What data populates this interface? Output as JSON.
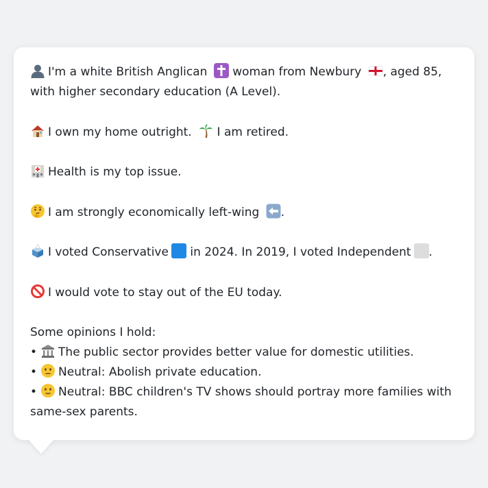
{
  "profile": {
    "line1_a": "I'm a white British Anglican",
    "line1_b": "woman from Newbury",
    "line1_c": ", aged 85, with higher secondary education (A Level).",
    "home": "I own my home outright.",
    "retired": "I am retired.",
    "health": "Health is my top issue.",
    "econ": "I am strongly economically left-wing",
    "econ_end": ".",
    "vote_a": "I voted Conservative",
    "vote_b": "in 2024. In 2019, I voted Independent",
    "vote_end": ".",
    "eu": "I would vote to stay out of the EU today.",
    "opinions_title": "Some opinions I hold:",
    "opinions": [
      {
        "bullet": "•",
        "text": "The public sector provides better value for domestic utilities."
      },
      {
        "bullet": "•",
        "text": "Neutral: Abolish private education."
      },
      {
        "bullet": "•",
        "text": "Neutral: BBC children's TV shows should portray more families with same-sex parents."
      }
    ]
  },
  "icons": {
    "person": "person-icon",
    "cross": "latin-cross-icon",
    "england_flag": "england-flag-icon",
    "house": "house-icon",
    "palm": "palm-tree-icon",
    "hospital": "hospital-icon",
    "thinking": "thinking-face-icon",
    "left_arrow": "left-arrow-icon",
    "ballot": "ballot-box-icon",
    "no_entry": "prohibited-icon",
    "classical_building": "classical-building-icon",
    "neutral_face": "neutral-face-icon"
  },
  "colors": {
    "conservative": "#1e88e5",
    "independent": "#dddddd",
    "text": "#1f2328",
    "background": "#f1f2f4",
    "bubble": "#ffffff"
  }
}
